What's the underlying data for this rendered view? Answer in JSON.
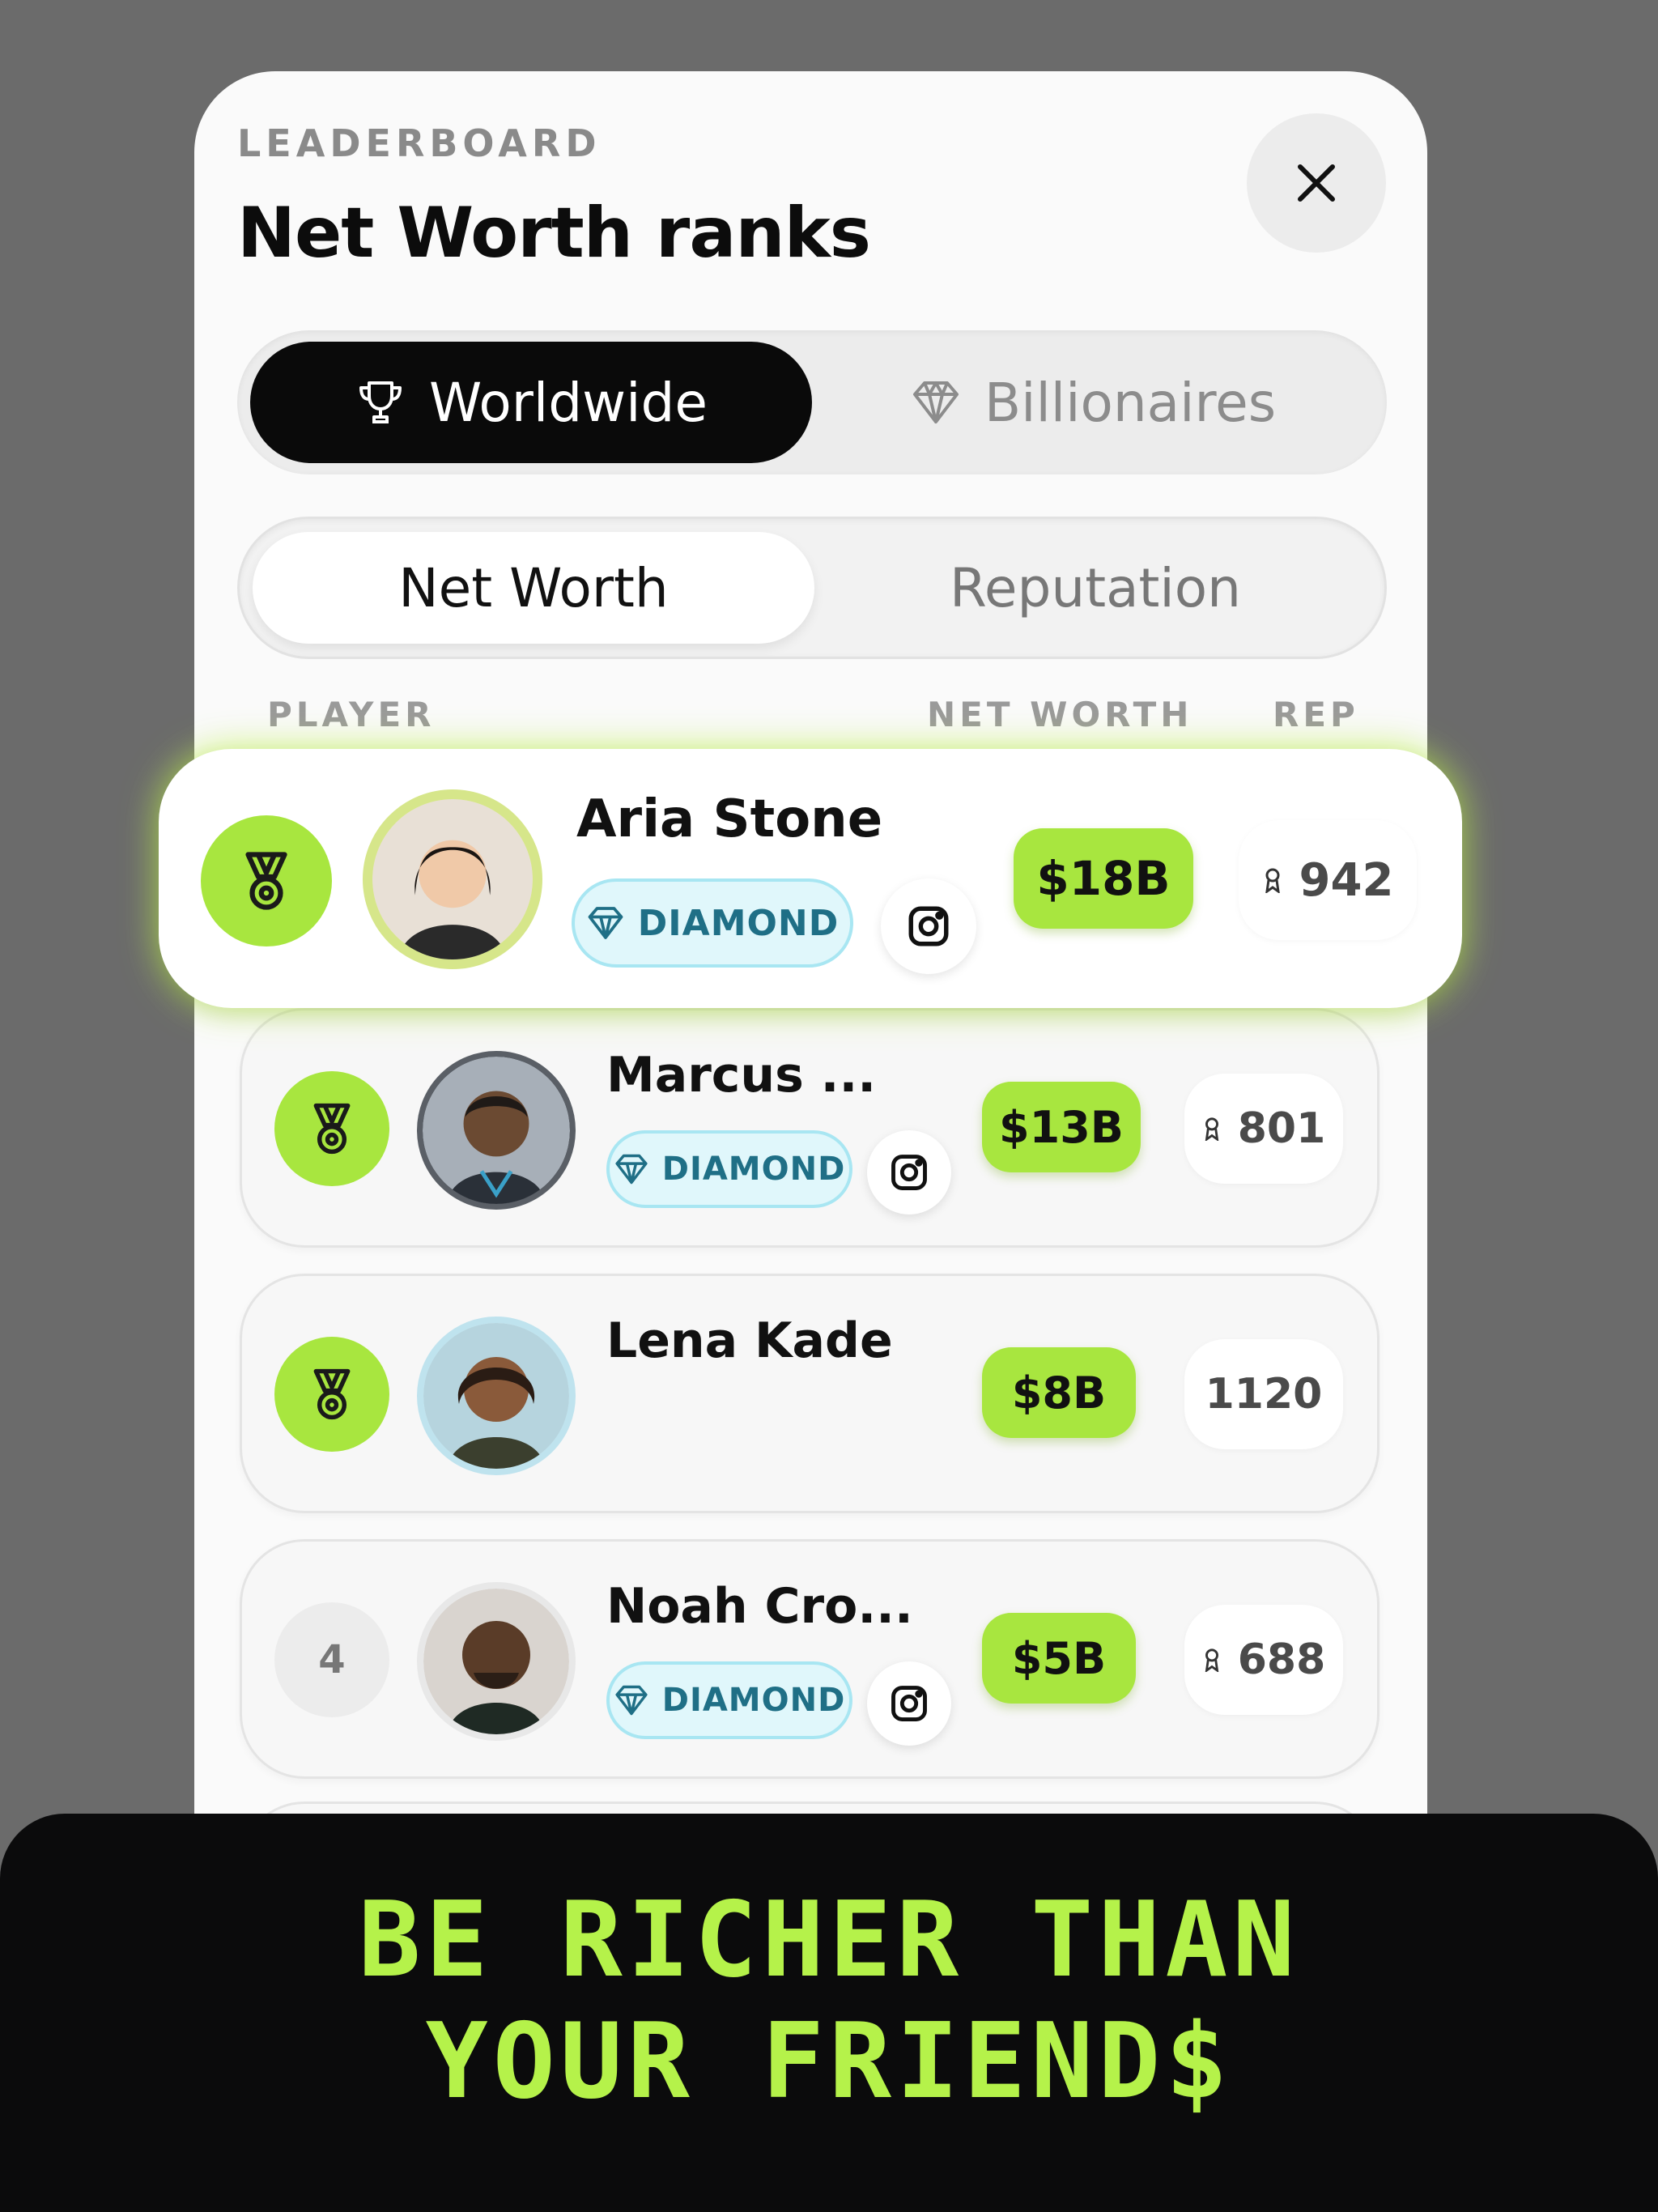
{
  "header": {
    "eyebrow": "LEADERBOARD",
    "title": "Net Worth ranks"
  },
  "scope_tabs": [
    {
      "label": "Worldwide",
      "icon": "trophy-icon",
      "selected": true
    },
    {
      "label": "Billionaires",
      "icon": "diamond-icon",
      "selected": false
    }
  ],
  "metric_tabs": [
    {
      "label": "Net Worth",
      "selected": true
    },
    {
      "label": "Reputation",
      "selected": false
    }
  ],
  "columns": {
    "player": "PLAYER",
    "net_worth": "NET WORTH",
    "rep": "REP"
  },
  "players": [
    {
      "rank": "1",
      "rank_icon": "medal-icon",
      "name": "Aria Stone",
      "tier": "DIAMOND",
      "social": "instagram-icon",
      "net_worth": "$18B",
      "rep": "942",
      "rep_icon": "ribbon-icon"
    },
    {
      "rank": "2",
      "rank_icon": "medal-icon",
      "name": "Marcus ...",
      "tier": "DIAMOND",
      "social": "instagram-icon",
      "net_worth": "$13B",
      "rep": "801",
      "rep_icon": "ribbon-icon"
    },
    {
      "rank": "3",
      "rank_icon": "medal-icon",
      "name": "Lena Kade",
      "net_worth": "$8B",
      "rep": "1120"
    },
    {
      "rank": "4",
      "name": "Noah Cro...",
      "tier": "DIAMOND",
      "social": "instagram-icon",
      "net_worth": "$5B",
      "rep": "688",
      "rep_icon": "ribbon-icon"
    }
  ],
  "tagline": {
    "line1": "BE RICHER THAN",
    "line2": "YOUR FRIEND$"
  },
  "colors": {
    "accent": "#a8e63f",
    "tagline": "#b5f24a",
    "banner": "#0b0b0c",
    "tier_bg": "#e0f7fb"
  }
}
